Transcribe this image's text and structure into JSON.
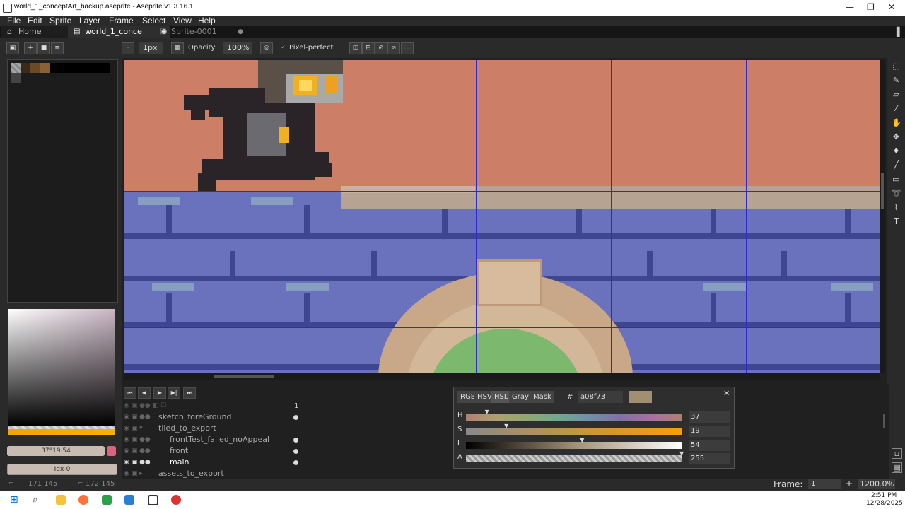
{
  "window": {
    "title": "world_1_conceptArt_backup.aseprite - Aseprite v1.3.16.1",
    "min": "—",
    "max": "❐",
    "close": "✕"
  },
  "menu": [
    "File",
    "Edit",
    "Sprite",
    "Layer",
    "Frame",
    "Select",
    "View",
    "Help"
  ],
  "tabs": [
    {
      "label": "Home"
    },
    {
      "label": "world_1_conce"
    },
    {
      "label": "Sprite-0001"
    }
  ],
  "toolbar": {
    "brush_size": "1px",
    "opacity_label": "Opacity:",
    "opacity_value": "100%",
    "pixel_perfect": "Pixel-perfect"
  },
  "left": {
    "color_value": "37°19.54",
    "index": "Idx-0"
  },
  "timeline": {
    "frame_number": "1",
    "layers": [
      {
        "name": "sketch_foreGround",
        "indent": 0
      },
      {
        "name": "tiled_to_export",
        "indent": 0
      },
      {
        "name": "frontTest_failed_noAppeal",
        "indent": 1
      },
      {
        "name": "front",
        "indent": 1
      },
      {
        "name": "main",
        "indent": 1
      },
      {
        "name": "assets_to_export",
        "indent": 0
      }
    ]
  },
  "color_panel": {
    "modes": [
      "RGB",
      "HSV",
      "HSL",
      "Gray",
      "Mask"
    ],
    "hash": "#",
    "hex": "a08f73",
    "swatch": "#a08f73",
    "sliders": [
      {
        "label": "H",
        "value": "37",
        "fill": 0.1
      },
      {
        "label": "S",
        "value": "19",
        "fill": 0.19
      },
      {
        "label": "L",
        "value": "54",
        "fill": 0.54
      },
      {
        "label": "A",
        "value": "255",
        "fill": 1.0
      }
    ]
  },
  "status": {
    "pos1": "171 145",
    "pos2": "172 145",
    "frame_label": "Frame:",
    "frame_value": "1",
    "zoom": "1200.0%"
  },
  "clock": {
    "time": "2:51 PM",
    "date": "12/28/2025"
  },
  "colors": {
    "sky": "#cc7f66",
    "wall": "#6a72be",
    "accent": "#f8b000"
  }
}
